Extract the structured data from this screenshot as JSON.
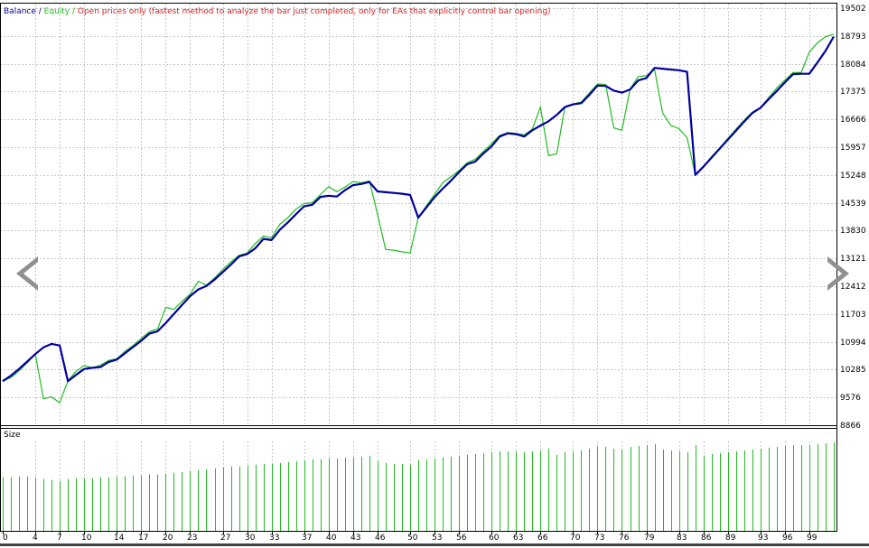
{
  "legend": {
    "balance": "Balance",
    "sep1": " / ",
    "equity": "Equity",
    "sep2": " / ",
    "mode": "Open prices only (fastest method to analyze the bar just completed, only for EAs that explicitly control bar opening)"
  },
  "colors": {
    "balance": "#0000a0",
    "equity": "#22bb22",
    "mode": "#e02020",
    "grid": "#c8c8c8",
    "size": "#22bb22",
    "arrow": "#909090"
  },
  "icons": {
    "prev": "chevron-left-icon",
    "next": "chevron-right-icon"
  },
  "chart_data": {
    "type": "line",
    "y_ticks": [
      8866,
      9576,
      10285,
      10994,
      11703,
      12412,
      13121,
      13830,
      14539,
      15248,
      15957,
      16666,
      17375,
      18084,
      18793,
      19502
    ],
    "x_ticks": [
      "0",
      "4",
      "7",
      "10",
      "14",
      "17",
      "20",
      "23",
      "27",
      "30",
      "33",
      "37",
      "40",
      "43",
      "46",
      "50",
      "53",
      "56",
      "60",
      "63",
      "66",
      "70",
      "73",
      "76",
      "79",
      "83",
      "86",
      "89",
      "93",
      "96",
      "99"
    ],
    "x_range": [
      0,
      102
    ],
    "y_range": [
      8866,
      19620
    ],
    "grid": true,
    "series": [
      {
        "name": "Balance",
        "x": [
          0,
          1,
          2,
          3,
          4,
          5,
          6,
          7,
          8,
          9,
          10,
          11,
          12,
          13,
          14,
          15,
          16,
          17,
          18,
          19,
          20,
          21,
          22,
          23,
          24,
          25,
          26,
          27,
          28,
          29,
          30,
          31,
          32,
          33,
          34,
          35,
          36,
          37,
          38,
          39,
          40,
          41,
          42,
          43,
          44,
          45,
          46,
          47,
          48,
          49,
          50,
          51,
          52,
          53,
          54,
          55,
          56,
          57,
          58,
          59,
          60,
          61,
          62,
          63,
          64,
          65,
          66,
          67,
          68,
          69,
          70,
          71,
          72,
          73,
          74,
          75,
          76,
          77,
          78,
          79,
          80,
          81,
          82,
          83,
          84,
          85,
          86,
          87,
          88,
          89,
          90,
          91,
          92,
          93,
          94,
          95,
          96,
          97,
          98,
          99,
          100,
          101,
          102
        ],
        "values": [
          9990,
          10130,
          10300,
          10490,
          10680,
          10850,
          10940,
          10900,
          9990,
          10150,
          10300,
          10330,
          10350,
          10480,
          10540,
          10700,
          10860,
          11020,
          11200,
          11260,
          11470,
          11700,
          11930,
          12160,
          12330,
          12420,
          12580,
          12770,
          12960,
          13170,
          13230,
          13380,
          13620,
          13590,
          13850,
          14040,
          14250,
          14450,
          14490,
          14690,
          14720,
          14700,
          14860,
          14990,
          15020,
          15070,
          14830,
          14810,
          14790,
          14770,
          14740,
          14160,
          14420,
          14680,
          14900,
          15100,
          15320,
          15520,
          15590,
          15800,
          15980,
          16230,
          16310,
          16290,
          16230,
          16390,
          16510,
          16620,
          16780,
          16980,
          17050,
          17080,
          17290,
          17530,
          17520,
          17400,
          17350,
          17430,
          17660,
          17720,
          17980,
          17960,
          17940,
          17920,
          17880,
          15250,
          15460,
          15690,
          15920,
          16150,
          16380,
          16610,
          16830,
          16960,
          17180,
          17390,
          17610,
          17820,
          17830,
          17830,
          18120,
          18420,
          18780
        ]
      },
      {
        "name": "Equity",
        "x": [
          0,
          1,
          2,
          3,
          4,
          5,
          6,
          7,
          8,
          9,
          10,
          11,
          12,
          13,
          14,
          15,
          16,
          17,
          18,
          19,
          20,
          21,
          22,
          23,
          24,
          25,
          26,
          27,
          28,
          29,
          30,
          31,
          32,
          33,
          34,
          35,
          36,
          37,
          38,
          39,
          40,
          41,
          42,
          43,
          44,
          45,
          46,
          47,
          48,
          49,
          50,
          51,
          52,
          53,
          54,
          55,
          56,
          57,
          58,
          59,
          60,
          61,
          62,
          63,
          64,
          65,
          66,
          67,
          68,
          69,
          70,
          71,
          72,
          73,
          74,
          75,
          76,
          77,
          78,
          79,
          80,
          81,
          82,
          83,
          84,
          85,
          86,
          87,
          88,
          89,
          90,
          91,
          92,
          93,
          94,
          95,
          96,
          97,
          98,
          99,
          100,
          101,
          102
        ],
        "values": [
          9990,
          10080,
          10250,
          10460,
          10680,
          9540,
          9590,
          9440,
          10000,
          10240,
          10390,
          10330,
          10400,
          10520,
          10560,
          10750,
          10900,
          11080,
          11250,
          11320,
          11870,
          11820,
          12020,
          12210,
          12540,
          12440,
          12620,
          12840,
          13030,
          13200,
          13260,
          13500,
          13690,
          13650,
          13990,
          14160,
          14380,
          14520,
          14540,
          14750,
          14950,
          14820,
          14940,
          15080,
          15050,
          15100,
          14250,
          13350,
          13330,
          13290,
          13260,
          14160,
          14460,
          14750,
          15050,
          15200,
          15360,
          15560,
          15650,
          15850,
          16050,
          16260,
          16330,
          16310,
          16270,
          16420,
          16980,
          15740,
          15790,
          16990,
          17060,
          17110,
          17340,
          17570,
          17560,
          16450,
          16390,
          17440,
          17760,
          17780,
          17940,
          16830,
          16510,
          16430,
          16200,
          15250,
          15470,
          15720,
          15940,
          16180,
          16420,
          16650,
          16850,
          16970,
          17220,
          17470,
          17670,
          17860,
          17860,
          18380,
          18620,
          18780,
          18840
        ]
      }
    ],
    "size_panel": {
      "label": "Size",
      "values": [
        0.6,
        0.6,
        0.61,
        0.61,
        0.6,
        0.58,
        0.57,
        0.56,
        0.58,
        0.59,
        0.59,
        0.59,
        0.6,
        0.6,
        0.61,
        0.61,
        0.62,
        0.62,
        0.63,
        0.63,
        0.64,
        0.65,
        0.66,
        0.67,
        0.68,
        0.69,
        0.7,
        0.71,
        0.72,
        0.72,
        0.73,
        0.74,
        0.75,
        0.75,
        0.76,
        0.77,
        0.78,
        0.79,
        0.8,
        0.8,
        0.81,
        0.81,
        0.82,
        0.82,
        0.83,
        0.84,
        0.78,
        0.76,
        0.75,
        0.75,
        0.74,
        0.79,
        0.8,
        0.81,
        0.82,
        0.83,
        0.84,
        0.85,
        0.86,
        0.87,
        0.88,
        0.89,
        0.89,
        0.89,
        0.88,
        0.89,
        0.9,
        0.92,
        0.85,
        0.88,
        0.89,
        0.9,
        0.92,
        0.94,
        0.94,
        0.92,
        0.91,
        0.94,
        0.95,
        0.96,
        0.97,
        0.91,
        0.9,
        0.89,
        0.88,
        0.96,
        0.84,
        0.86,
        0.87,
        0.88,
        0.89,
        0.9,
        0.91,
        0.92,
        0.93,
        0.94,
        0.95,
        0.96,
        0.96,
        0.96,
        0.97,
        0.98,
        0.99
      ]
    }
  }
}
